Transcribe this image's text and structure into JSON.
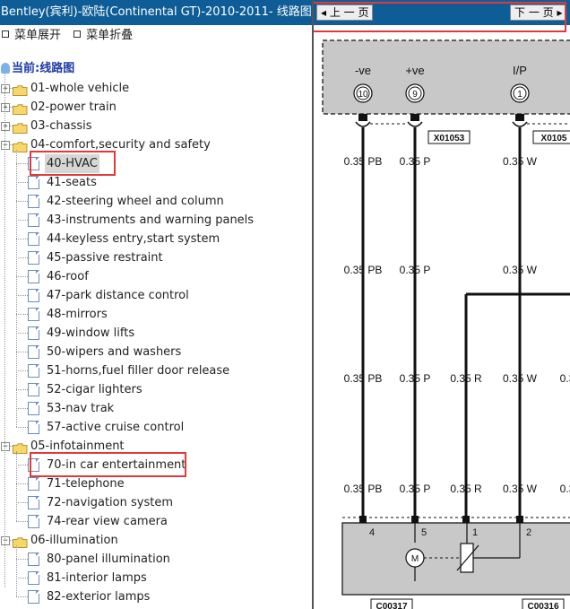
{
  "window": {
    "title": "Bentley(宾利)-欧陆(Continental GT)-2010-2011- 线路图."
  },
  "menu": {
    "expand": "菜单展开",
    "collapse": "菜单折叠"
  },
  "tree": {
    "root": "当前:线路图",
    "nodes": [
      {
        "label": "01-whole vehicle",
        "kind": "folder",
        "level": 0,
        "expanded": false
      },
      {
        "label": "02-power train",
        "kind": "folder",
        "level": 0,
        "expanded": false
      },
      {
        "label": "03-chassis",
        "kind": "folder",
        "level": 0,
        "expanded": false
      },
      {
        "label": "04-comfort,security and safety",
        "kind": "folder",
        "level": 0,
        "expanded": true
      },
      {
        "label": "40-HVAC",
        "kind": "doc",
        "level": 1,
        "selected": true,
        "highlighted": true
      },
      {
        "label": "41-seats",
        "kind": "doc",
        "level": 1
      },
      {
        "label": "42-steering wheel and column",
        "kind": "doc",
        "level": 1
      },
      {
        "label": "43-instruments and warning panels",
        "kind": "doc",
        "level": 1
      },
      {
        "label": "44-keyless entry,start system",
        "kind": "doc",
        "level": 1
      },
      {
        "label": "45-passive restraint",
        "kind": "doc",
        "level": 1
      },
      {
        "label": "46-roof",
        "kind": "doc",
        "level": 1
      },
      {
        "label": "47-park distance control",
        "kind": "doc",
        "level": 1
      },
      {
        "label": "48-mirrors",
        "kind": "doc",
        "level": 1
      },
      {
        "label": "49-window lifts",
        "kind": "doc",
        "level": 1
      },
      {
        "label": "50-wipers and washers",
        "kind": "doc",
        "level": 1
      },
      {
        "label": "51-horns,fuel filler door release",
        "kind": "doc",
        "level": 1
      },
      {
        "label": "52-cigar lighters",
        "kind": "doc",
        "level": 1
      },
      {
        "label": "53-nav trak",
        "kind": "doc",
        "level": 1
      },
      {
        "label": "57-active cruise control",
        "kind": "doc",
        "level": 1
      },
      {
        "label": "05-infotainment",
        "kind": "folder",
        "level": 0,
        "expanded": true
      },
      {
        "label": "70-in car entertainment",
        "kind": "doc",
        "level": 1,
        "highlighted": true
      },
      {
        "label": "71-telephone",
        "kind": "doc",
        "level": 1
      },
      {
        "label": "72-navigation system",
        "kind": "doc",
        "level": 1
      },
      {
        "label": "74-rear view camera",
        "kind": "doc",
        "level": 1
      },
      {
        "label": "06-illumination",
        "kind": "folder",
        "level": 0,
        "expanded": true
      },
      {
        "label": "80-panel illumination",
        "kind": "doc",
        "level": 1
      },
      {
        "label": "81-interior lamps",
        "kind": "doc",
        "level": 1
      },
      {
        "label": "82-exterior lamps",
        "kind": "doc",
        "level": 1
      }
    ]
  },
  "nav": {
    "prev": "上 一 页",
    "next": "下 一 页"
  },
  "diagram": {
    "pins_top": [
      {
        "label": "-ve",
        "num": "10"
      },
      {
        "label": "+ve",
        "num": "9"
      },
      {
        "label": "I/P",
        "num": "1"
      }
    ],
    "connectors_top": [
      "X01053",
      "X0105"
    ],
    "wire_rows": [
      [
        "0.35 PB",
        "0.35 P",
        "0.35 W"
      ],
      [
        "0.35 PB",
        "0.35 P",
        "0.35 W"
      ],
      [
        "0.35 PB",
        "0.35 P",
        "0.35 R",
        "0.35 W",
        "0.3"
      ],
      [
        "0.35 PB",
        "0.35 P",
        "0.35 R",
        "0.35 W",
        "0.3"
      ]
    ],
    "pins_bottom": [
      "4",
      "5",
      "1",
      "2"
    ],
    "motor_label": "M",
    "connectors_bottom": [
      "C00317",
      "C00316"
    ]
  },
  "colors": {
    "titlebar": "#0f5d96",
    "highlight": "#e03a3a",
    "module": "#c8c8c8"
  }
}
